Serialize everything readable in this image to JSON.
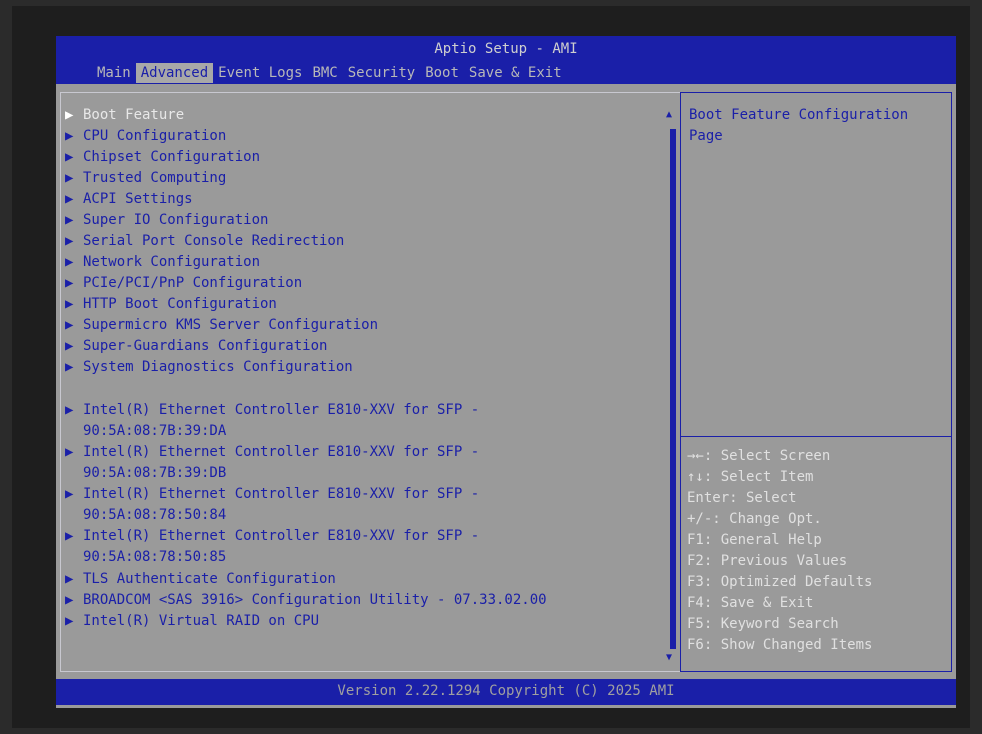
{
  "header": {
    "title": "Aptio Setup - AMI",
    "tabs": [
      {
        "label": "Main"
      },
      {
        "label": "Advanced"
      },
      {
        "label": "Event Logs"
      },
      {
        "label": "BMC"
      },
      {
        "label": "Security"
      },
      {
        "label": "Boot"
      },
      {
        "label": "Save & Exit"
      }
    ]
  },
  "menu": {
    "items": [
      {
        "label": "Boot Feature"
      },
      {
        "label": "CPU Configuration"
      },
      {
        "label": "Chipset Configuration"
      },
      {
        "label": "Trusted Computing"
      },
      {
        "label": "ACPI Settings"
      },
      {
        "label": "Super IO Configuration"
      },
      {
        "label": "Serial Port Console Redirection"
      },
      {
        "label": "Network Configuration"
      },
      {
        "label": "PCIe/PCI/PnP Configuration"
      },
      {
        "label": "HTTP Boot Configuration"
      },
      {
        "label": "Supermicro KMS Server Configuration"
      },
      {
        "label": "Super-Guardians Configuration"
      },
      {
        "label": "System Diagnostics Configuration"
      }
    ],
    "nics": [
      {
        "line1": "Intel(R) Ethernet Controller E810-XXV for SFP -",
        "line2": "90:5A:08:7B:39:DA"
      },
      {
        "line1": "Intel(R) Ethernet Controller E810-XXV for SFP -",
        "line2": "90:5A:08:7B:39:DB"
      },
      {
        "line1": "Intel(R) Ethernet Controller E810-XXV for SFP -",
        "line2": "90:5A:08:78:50:84"
      },
      {
        "line1": "Intel(R) Ethernet Controller E810-XXV for SFP -",
        "line2": "90:5A:08:78:50:85"
      }
    ],
    "extra": [
      {
        "label": "TLS Authenticate Configuration"
      },
      {
        "label": "BROADCOM <SAS 3916> Configuration Utility - 07.33.02.00"
      },
      {
        "label": "Intel(R) Virtual RAID on CPU"
      }
    ]
  },
  "help": {
    "text": "Boot Feature Configuration Page"
  },
  "keys": [
    {
      "label": "→←: Select Screen"
    },
    {
      "label": "↑↓: Select Item"
    },
    {
      "label": "Enter: Select"
    },
    {
      "label": "+/-: Change Opt."
    },
    {
      "label": "F1: General Help"
    },
    {
      "label": "F2: Previous Values"
    },
    {
      "label": "F3: Optimized Defaults"
    },
    {
      "label": "F4: Save & Exit"
    },
    {
      "label": "F5: Keyword Search"
    },
    {
      "label": "F6: Show Changed Items"
    }
  ],
  "footer": {
    "version": "Version 2.22.1294 Copyright (C) 2025 AMI"
  },
  "colors": {
    "bar": "#1a1fa8",
    "background": "#9a9a9a",
    "menu_text": "#1a1fa8"
  }
}
